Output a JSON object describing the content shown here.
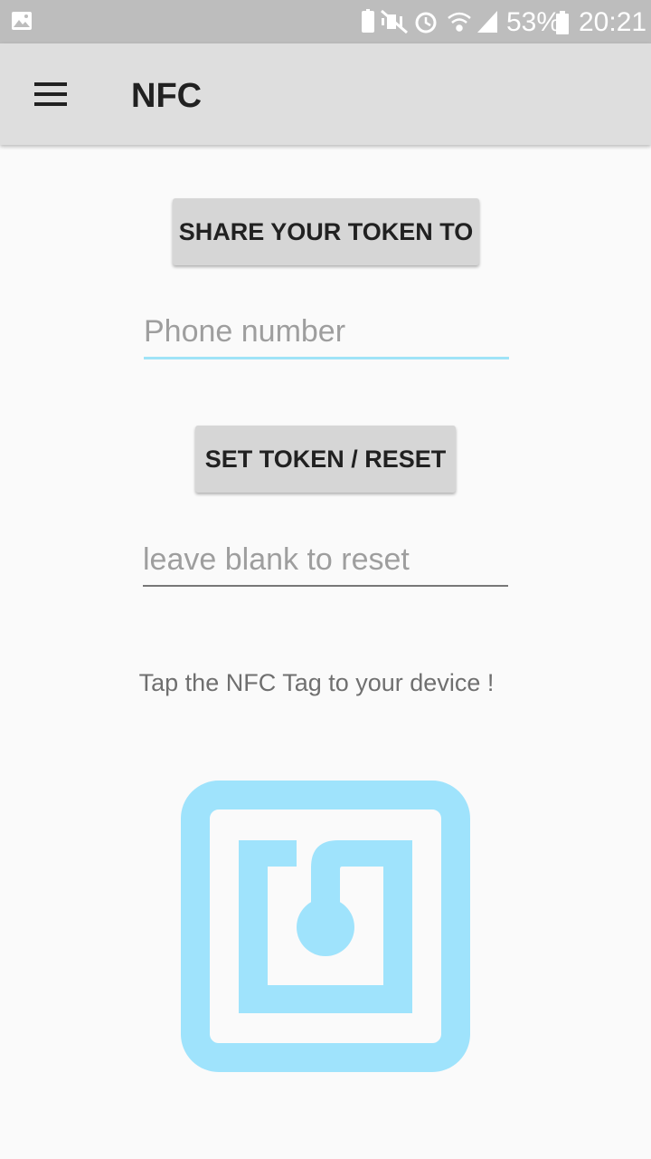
{
  "status_bar": {
    "battery_percent": "53%",
    "time": "20:21",
    "icons": [
      "gallery-icon",
      "usb-icon",
      "mute-vibrate-icon",
      "alarm-icon",
      "wifi-icon",
      "signal-icon",
      "battery-icon"
    ]
  },
  "app_bar": {
    "title": "NFC",
    "menu_icon": "hamburger-menu-icon"
  },
  "main": {
    "share_button_label": "SHARE YOUR TOKEN TO",
    "phone_field": {
      "placeholder": "Phone number",
      "value": ""
    },
    "set_token_button_label": "SET TOKEN / RESET",
    "token_field": {
      "placeholder": "leave blank to reset",
      "value": ""
    },
    "instruction": "Tap the NFC Tag to your device !",
    "nfc_icon": "nfc-tag-icon"
  },
  "colors": {
    "accent": "#9fe3f7",
    "nfc_logo": "#9fe3fc",
    "app_bar": "#dedede",
    "button": "#d6d6d6",
    "status_bar": "#bdbdbd"
  }
}
